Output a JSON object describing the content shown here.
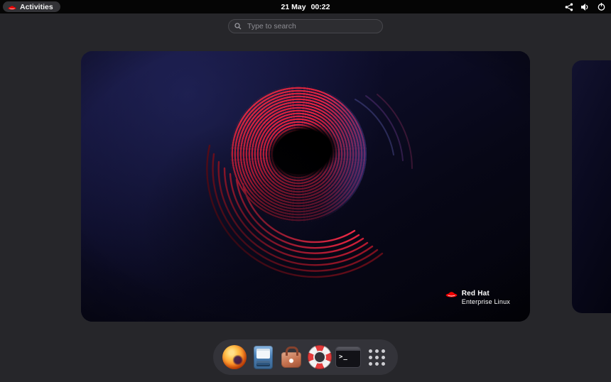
{
  "topbar": {
    "activities_label": "Activities",
    "clock_date": "21 May",
    "clock_time": "00:22"
  },
  "search": {
    "placeholder": "Type to search"
  },
  "wallpaper": {
    "brand_line1": "Red Hat",
    "brand_line2": "Enterprise Linux"
  },
  "dock": {
    "items": [
      {
        "name": "firefox",
        "icon": "firefox-icon"
      },
      {
        "name": "files",
        "icon": "files-icon"
      },
      {
        "name": "software",
        "icon": "software-icon"
      },
      {
        "name": "help",
        "icon": "help-icon"
      },
      {
        "name": "terminal",
        "icon": "terminal-icon"
      },
      {
        "name": "show-applications",
        "icon": "app-grid-icon"
      }
    ]
  },
  "status_icons": [
    "network-icon",
    "volume-icon",
    "power-icon"
  ],
  "colors": {
    "accent": "#ee0000",
    "topbar_bg": "#050505",
    "overview_bg": "#26262a",
    "dock_bg": "#343439",
    "wallpaper_red": "#d81e3c",
    "wallpaper_navy": "#0d0d28"
  }
}
